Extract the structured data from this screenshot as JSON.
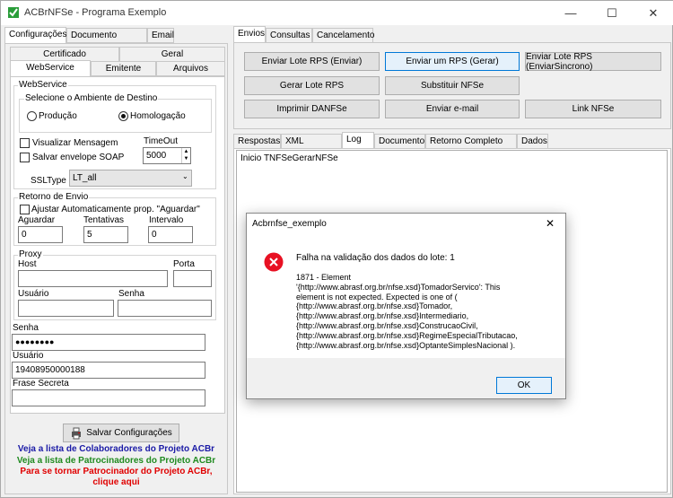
{
  "window": {
    "title": "ACBrNFSe - Programa Exemplo",
    "minimize": "—",
    "maximize": "☐",
    "close": "✕"
  },
  "left_tabs": [
    "Configurações",
    "Documento Auxiliar",
    "Email"
  ],
  "sub_tabs_row1": [
    "Certificado",
    "Geral"
  ],
  "sub_tabs_row2": [
    "WebService",
    "Emitente",
    "Arquivos"
  ],
  "webservice": {
    "group_label": "WebService",
    "ambiente_label": "Selecione o Ambiente de Destino",
    "producao": "Produção",
    "homologacao": "Homologação",
    "selected": "Homologação",
    "visualizar": "Visualizar Mensagem",
    "salvar_envelope": "Salvar envelope SOAP",
    "timeout_label": "TimeOut",
    "timeout_value": "5000",
    "ssltype_label": "SSLType",
    "ssltype_value": "LT_all"
  },
  "retorno": {
    "group_label": "Retorno de Envio",
    "ajustar": "Ajustar Automaticamente prop. \"Aguardar\"",
    "aguardar_label": "Aguardar",
    "aguardar_value": "0",
    "tentativas_label": "Tentativas",
    "tentativas_value": "5",
    "intervalo_label": "Intervalo",
    "intervalo_value": "0"
  },
  "proxy": {
    "group_label": "Proxy",
    "host": "Host",
    "porta": "Porta",
    "usuario": "Usuário",
    "senha": "Senha"
  },
  "senha_label": "Senha",
  "senha_value": "●●●●●●●●",
  "usuario_label": "Usuário",
  "usuario_value": "19408950000188",
  "frase_label": "Frase Secreta",
  "salvar_config": "Salvar Configurações",
  "links": {
    "colaboradores": "Veja a lista de Colaboradores do Projeto ACBr",
    "patrocinadores": "Veja a lista de Patrocinadores do Projeto ACBr",
    "patrocinar1": "Para se tornar Patrocinador do Projeto ACBr,",
    "patrocinar2": "clique aqui"
  },
  "right_tabs": [
    "Envios",
    "Consultas",
    "Cancelamento"
  ],
  "buttons": [
    "Enviar Lote RPS (Enviar)",
    "Enviar um RPS (Gerar)",
    "Enviar Lote RPS (EnviarSincrono)",
    "Gerar Lote RPS",
    "Substituir NFSe",
    "Imprimir DANFSe",
    "Enviar e-mail",
    "Link NFSe"
  ],
  "resp_tabs": [
    "Respostas",
    "XML Resposta",
    "Log",
    "Documento",
    "Retorno Completo WS",
    "Dados"
  ],
  "log_text": "Inicio TNFSeGerarNFSe",
  "dialog": {
    "title": "Acbrnfse_exemplo",
    "close": "✕",
    "heading": "Falha na validação dos dados do lote: 1",
    "lines": [
      "1871 - Element",
      "'{http://www.abrasf.org.br/nfse.xsd}TomadorServico': This",
      "element is not expected. Expected is one of (",
      "{http://www.abrasf.org.br/nfse.xsd}Tomador,",
      "{http://www.abrasf.org.br/nfse.xsd}Intermediario,",
      "{http://www.abrasf.org.br/nfse.xsd}ConstrucaoCivil,",
      "{http://www.abrasf.org.br/nfse.xsd}RegimeEspecialTributacao,",
      "{http://www.abrasf.org.br/nfse.xsd}OptanteSimplesNacional )."
    ],
    "ok": "OK"
  },
  "colors": {
    "error": "#e81123",
    "link_blue": "#1a1aa6",
    "link_green": "#1f8a1f",
    "link_red": "#e00000",
    "focus": "#0078d7"
  }
}
